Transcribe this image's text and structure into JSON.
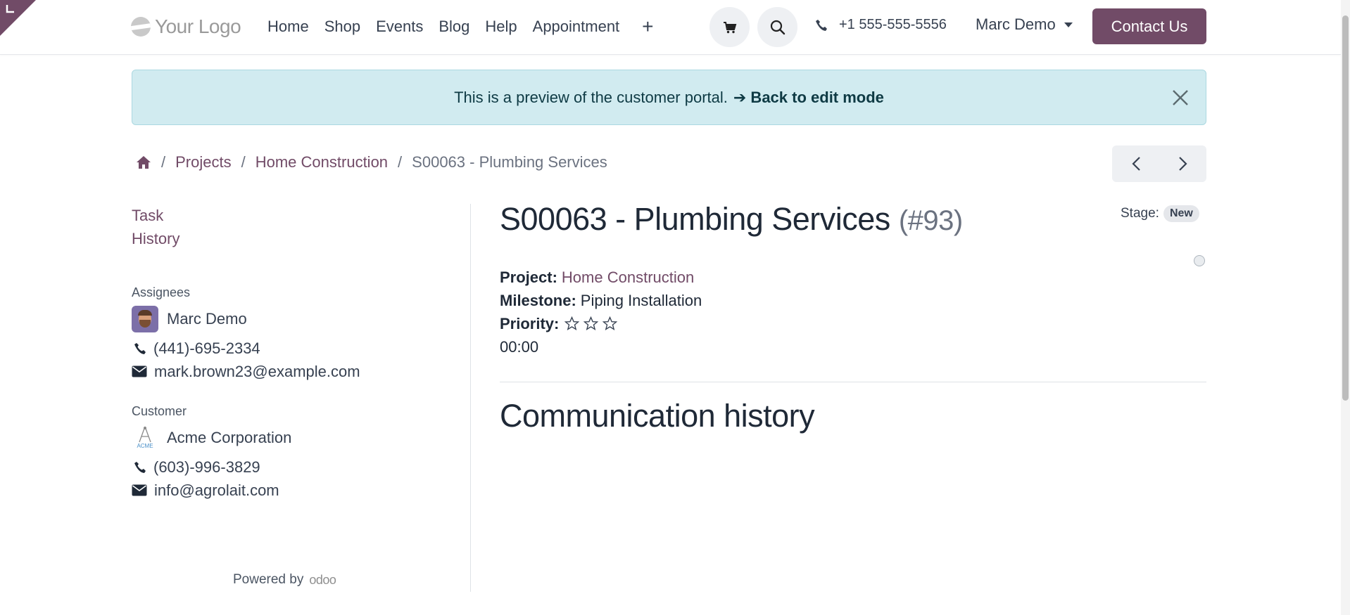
{
  "header": {
    "logo_text": "Your Logo",
    "nav": [
      "Home",
      "Shop",
      "Events",
      "Blog",
      "Help",
      "Appointment"
    ],
    "phone": "+1 555-555-5556",
    "user": "Marc Demo",
    "contact_button": "Contact Us"
  },
  "banner": {
    "text": "This is a preview of the customer portal.",
    "back_link": "➔ Back to edit mode"
  },
  "breadcrumb": {
    "projects": "Projects",
    "project": "Home Construction",
    "current": "S00063 - Plumbing Services"
  },
  "sidebar": {
    "links": [
      "Task",
      "History"
    ],
    "assignees_heading": "Assignees",
    "assignee": {
      "name": "Marc Demo",
      "phone": "(441)-695-2334",
      "email": "mark.brown23@example.com"
    },
    "customer_heading": "Customer",
    "customer": {
      "name": "Acme Corporation",
      "phone": "(603)-996-3829",
      "email": "info@agrolait.com"
    },
    "powered_by": "Powered by",
    "powered_brand": "odoo"
  },
  "task": {
    "title": "S00063 - Plumbing Services",
    "number": "(#93)",
    "stage_label": "Stage:",
    "stage": "New",
    "project_label": "Project:",
    "project": "Home Construction",
    "milestone_label": "Milestone:",
    "milestone": "Piping Installation",
    "priority_label": "Priority:",
    "priority_stars_filled": 0,
    "priority_stars_total": 3,
    "time": "00:00"
  },
  "communication_heading": "Communication history",
  "colors": {
    "brand": "#714b67",
    "banner_bg": "#d1ebf0"
  }
}
